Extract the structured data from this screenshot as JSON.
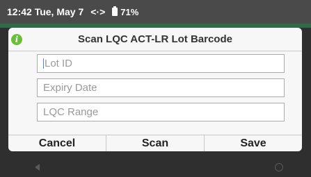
{
  "status_bar": {
    "time_date": "12:42 Tue, May 7",
    "data_indicator": "<·>",
    "battery_level": "71%"
  },
  "dialog": {
    "title": "Scan LQC ACT-LR Lot Barcode",
    "icon": "info-icon",
    "fields": [
      {
        "placeholder": "Lot ID",
        "value": ""
      },
      {
        "placeholder": "Expiry Date",
        "value": ""
      },
      {
        "placeholder": "LQC Range",
        "value": ""
      }
    ],
    "buttons": {
      "cancel": "Cancel",
      "scan": "Scan",
      "save": "Save"
    }
  },
  "colors": {
    "icon_green": "#6abf3a",
    "accent_green": "#2e6a45",
    "status_bar": "#4a4a4a"
  }
}
